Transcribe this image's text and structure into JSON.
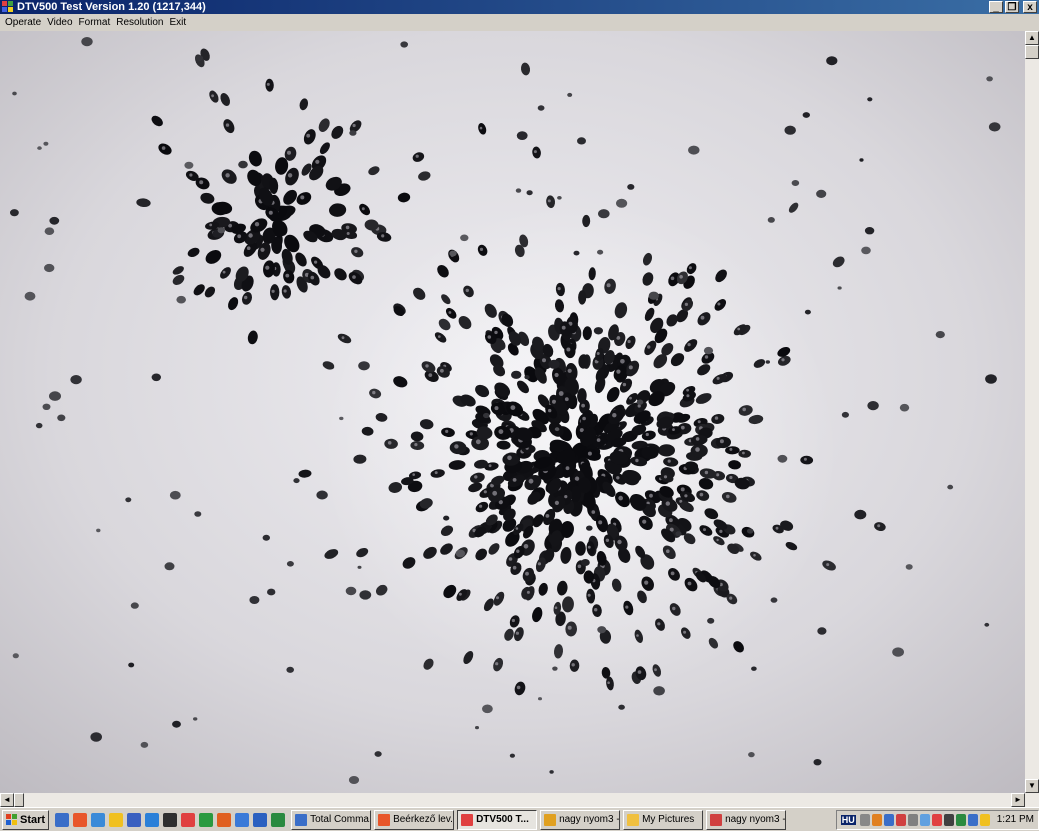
{
  "window": {
    "title": "DTV500 Test Version 1.20 (1217,344)",
    "controls": {
      "minimize": "_",
      "maximize": "❐",
      "close": "x"
    }
  },
  "menu": {
    "items": [
      "Operate",
      "Video",
      "Format",
      "Resolution",
      "Exit"
    ]
  },
  "scrollbars": {
    "up": "▲",
    "down": "▼",
    "left": "◄",
    "right": "►"
  },
  "taskbar": {
    "start_label": "Start",
    "quick_launch_colors": [
      "#3a6ec8",
      "#e8562a",
      "#3a8ad8",
      "#f0c020",
      "#3a60c0",
      "#2a80d8",
      "#303030",
      "#e04040",
      "#2a9a40",
      "#e06020",
      "#3a7ad8",
      "#2a60c0",
      "#2a8a40"
    ],
    "tasks": [
      {
        "label": "Total Comma...",
        "color": "#3a6ec8",
        "active": false
      },
      {
        "label": "Beérkező lev...",
        "color": "#e8562a",
        "active": false
      },
      {
        "label": "DTV500 T...",
        "color": "#e04040",
        "active": true
      },
      {
        "label": "nagy nyom3 -...",
        "color": "#e0a020",
        "active": false
      },
      {
        "label": "My Pictures",
        "color": "#f0c040",
        "active": false
      },
      {
        "label": "nagy nyom3 -...",
        "color": "#d04040",
        "active": false
      }
    ],
    "language": "HU",
    "tray_colors": [
      "#888888",
      "#e08020",
      "#3a6ec8",
      "#d04040",
      "#808080",
      "#60a0e0",
      "#e04040",
      "#404040",
      "#2a8a40",
      "#3a6ec8",
      "#f0c020"
    ],
    "clock": "1:21 PM"
  }
}
